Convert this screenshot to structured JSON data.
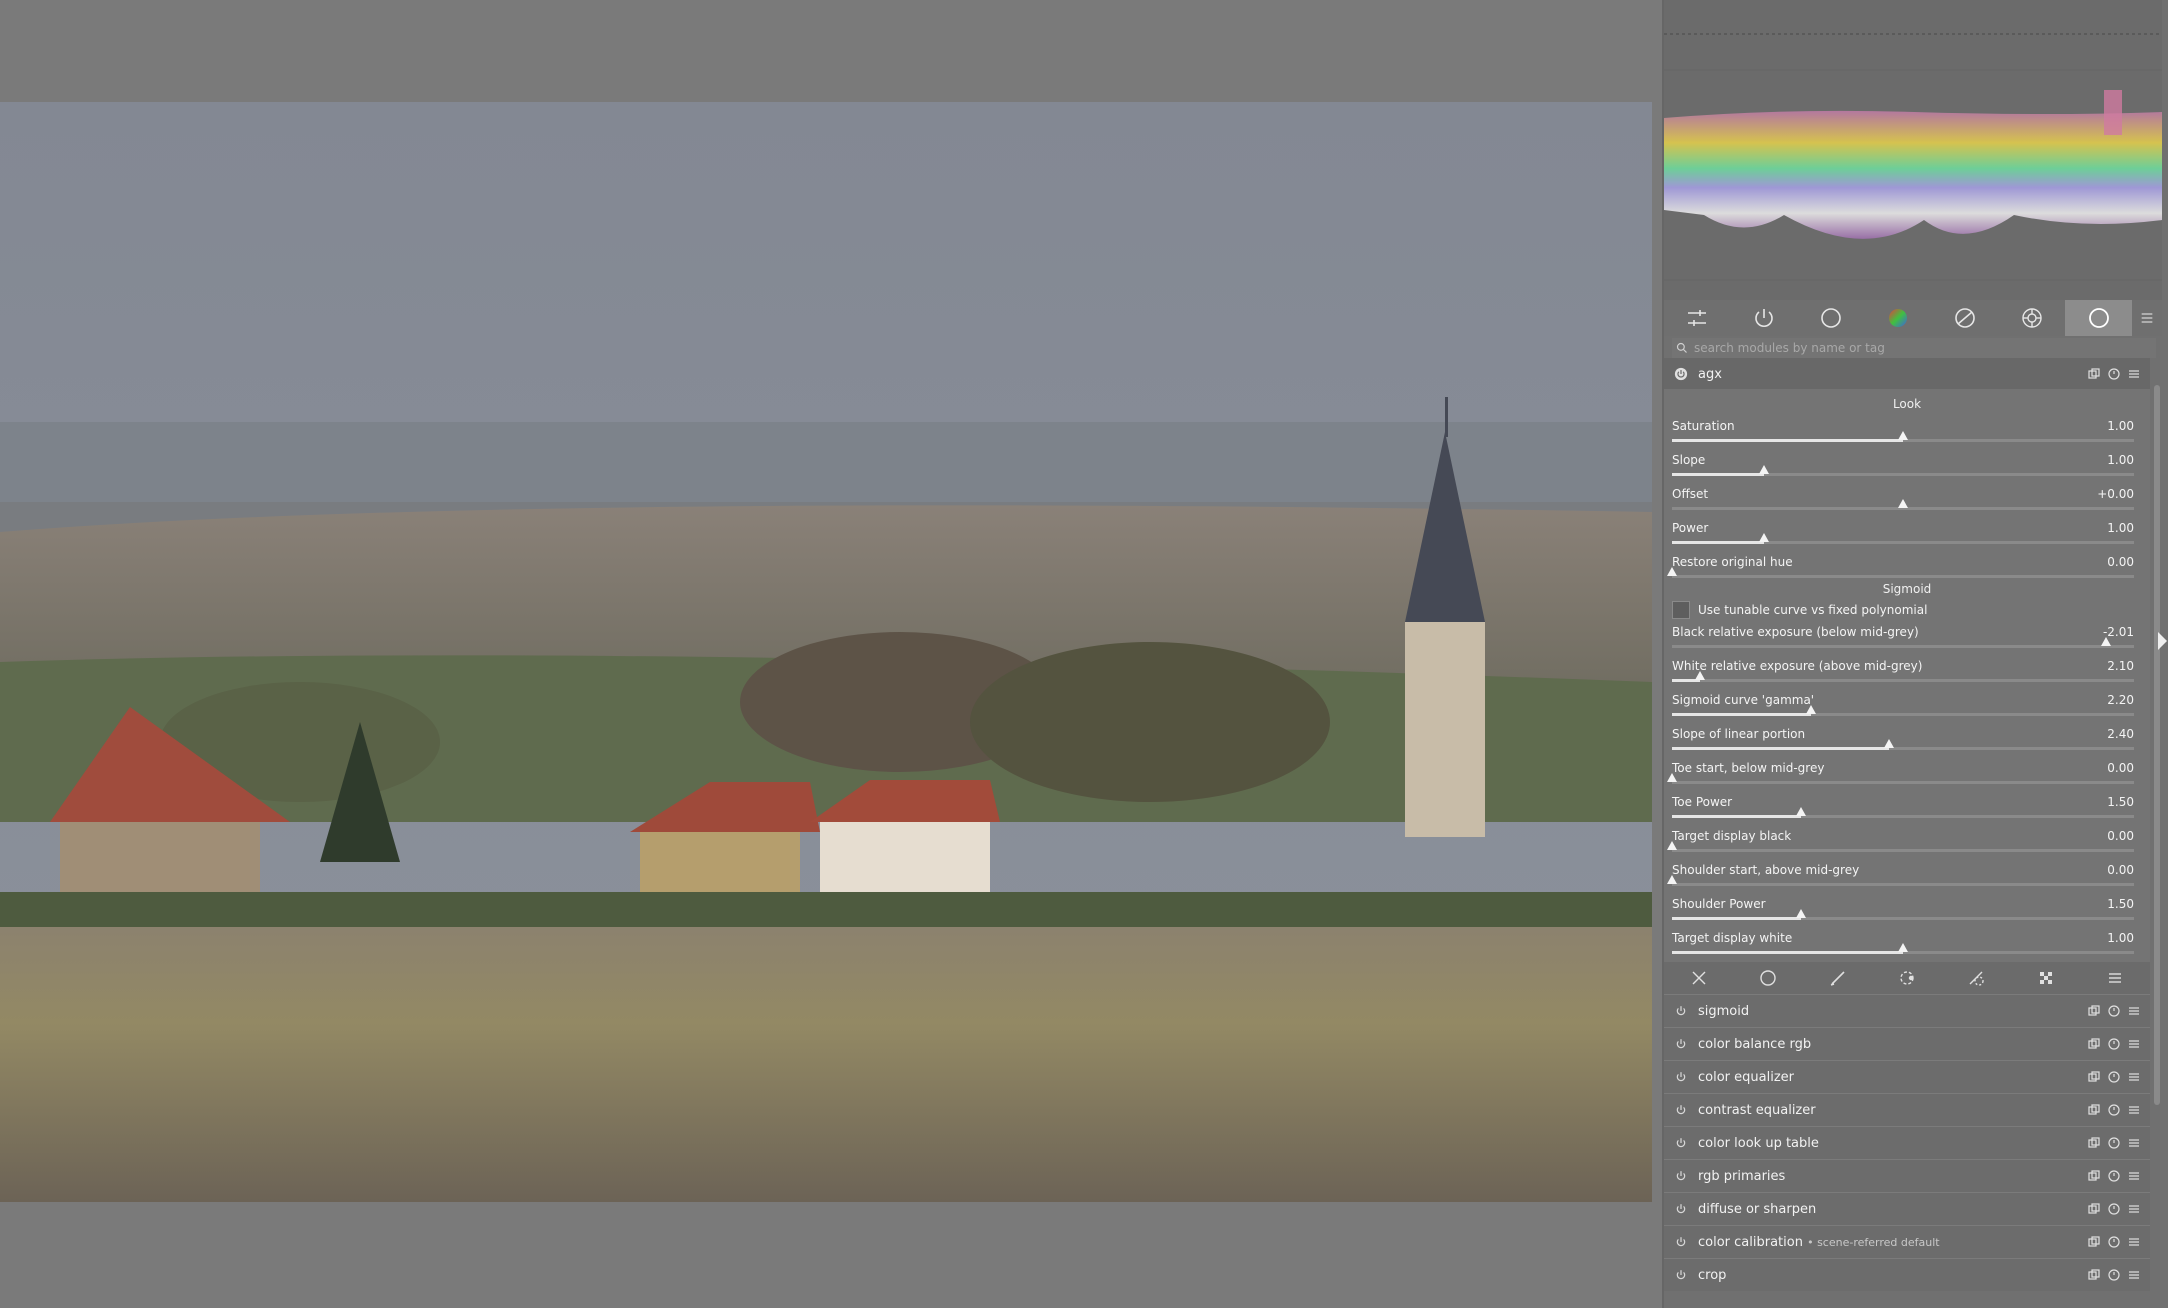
{
  "search": {
    "placeholder": "search modules by name or tag"
  },
  "group_tabs": [
    {
      "icon": "sliders-icon"
    },
    {
      "icon": "power-icon"
    },
    {
      "icon": "circle-icon"
    },
    {
      "icon": "color-wheel-icon"
    },
    {
      "icon": "correct-icon"
    },
    {
      "icon": "effect-icon"
    },
    {
      "icon": "circle-icon",
      "active": true
    }
  ],
  "agx": {
    "name": "agx",
    "look_label": "Look",
    "sigmoid_label": "Sigmoid",
    "tunable_label": "Use tunable curve vs fixed polynomial",
    "sliders": [
      {
        "label": "Saturation",
        "value": "1.00",
        "pos": 0.5,
        "fill": true
      },
      {
        "label": "Slope",
        "value": "1.00",
        "pos": 0.2,
        "fill": true
      },
      {
        "label": "Offset",
        "value": "+0.00",
        "pos": 0.5,
        "fill": false
      },
      {
        "label": "Power",
        "value": "1.00",
        "pos": 0.2,
        "fill": true
      },
      {
        "label": "Restore original hue",
        "value": "0.00",
        "pos": 0.0,
        "fill": false
      }
    ],
    "sigmoid_sliders": [
      {
        "label": "Black relative exposure (below mid-grey)",
        "value": "-2.01",
        "pos": 0.94,
        "fill": false
      },
      {
        "label": "White relative exposure (above mid-grey)",
        "value": "2.10",
        "pos": 0.06,
        "fill": true
      },
      {
        "label": "Sigmoid curve 'gamma'",
        "value": "2.20",
        "pos": 0.3,
        "fill": true
      },
      {
        "label": "Slope of linear portion",
        "value": "2.40",
        "pos": 0.47,
        "fill": true
      },
      {
        "label": "Toe start, below mid-grey",
        "value": "0.00",
        "pos": 0.0,
        "fill": false
      },
      {
        "label": "Toe Power",
        "value": "1.50",
        "pos": 0.28,
        "fill": true
      },
      {
        "label": "Target display black",
        "value": "0.00",
        "pos": 0.0,
        "fill": false
      },
      {
        "label": "Shoulder start, above mid-grey",
        "value": "0.00",
        "pos": 0.0,
        "fill": false
      },
      {
        "label": "Shoulder Power",
        "value": "1.50",
        "pos": 0.28,
        "fill": true
      },
      {
        "label": "Target display white",
        "value": "1.00",
        "pos": 0.5,
        "fill": true
      }
    ]
  },
  "modules": [
    {
      "name": "sigmoid",
      "preset": ""
    },
    {
      "name": "color balance rgb",
      "preset": ""
    },
    {
      "name": "color equalizer",
      "preset": ""
    },
    {
      "name": "contrast equalizer",
      "preset": ""
    },
    {
      "name": "color look up table",
      "preset": ""
    },
    {
      "name": "rgb primaries",
      "preset": ""
    },
    {
      "name": "diffuse or sharpen",
      "preset": ""
    },
    {
      "name": "color calibration",
      "preset": "• scene-referred default"
    },
    {
      "name": "crop",
      "preset": ""
    }
  ]
}
